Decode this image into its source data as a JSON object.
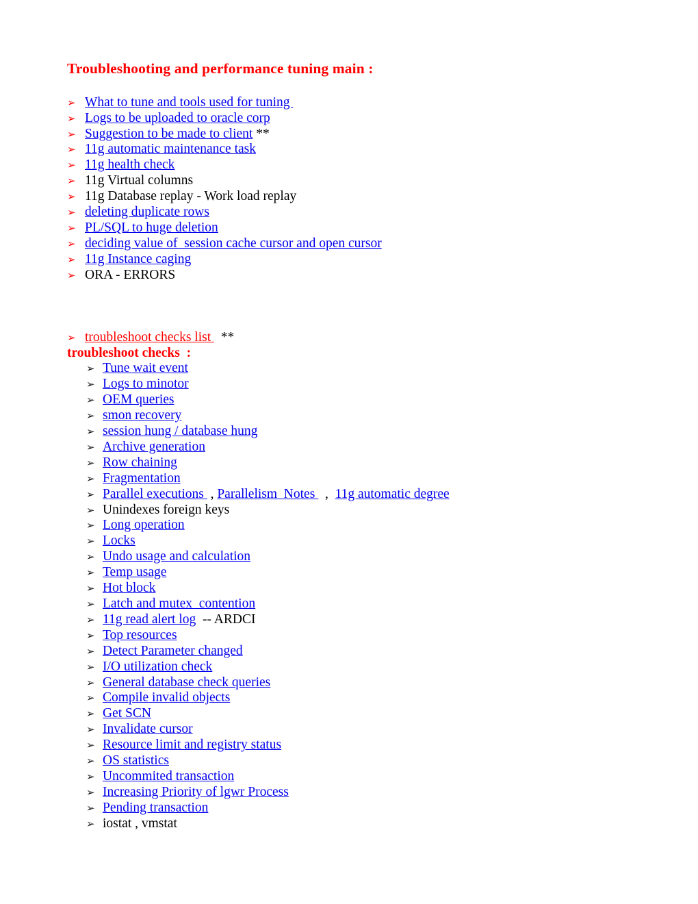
{
  "document": {
    "title": "Troubleshooting and performance tuning main :",
    "bullet_glyph": "➢",
    "colors": {
      "title": "#FF0000",
      "link": "#0000EE",
      "red_link": "#FF0000",
      "text": "#000000",
      "bullet_level1": "#FF0000",
      "bullet_level2": "#1A1A1A",
      "background": "#FFFFFF"
    }
  },
  "main_list": [
    {
      "link": "What to tune and tools used for tuning ",
      "suffix": ""
    },
    {
      "link": "Logs to be uploaded to oracle corp",
      "suffix": ""
    },
    {
      "link": "Suggestion to be made to client",
      "suffix": " **"
    },
    {
      "link": "11g automatic maintenance task",
      "suffix": ""
    },
    {
      "link": "11g health check",
      "suffix": ""
    },
    {
      "link": "",
      "suffix": "11g Virtual columns"
    },
    {
      "link": "",
      "suffix": "11g Database replay - Work load replay"
    },
    {
      "link": "deleting duplicate rows",
      "suffix": ""
    },
    {
      "link": "PL/SQL to huge deletion",
      "suffix": ""
    },
    {
      "link": "deciding value of  session cache cursor and open cursor",
      "suffix": ""
    },
    {
      "link": "11g Instance caging",
      "suffix": ""
    },
    {
      "link": "",
      "suffix": "ORA - ERRORS"
    }
  ],
  "checks_entry": {
    "link": "troubleshoot checks list ",
    "suffix": "  **"
  },
  "checks_heading": "troubleshoot checks  :",
  "checks_list": [
    {
      "link": "Tune wait event",
      "suffix": ""
    },
    {
      "link": "Logs to minotor",
      "suffix": ""
    },
    {
      "link": "OEM queries",
      "suffix": ""
    },
    {
      "link": "smon recovery",
      "suffix": ""
    },
    {
      "link": "session hung / database hung",
      "suffix": ""
    },
    {
      "link": "Archive generation",
      "suffix": ""
    },
    {
      "link": "Row chaining",
      "suffix": ""
    },
    {
      "link": "Fragmentation",
      "suffix": ""
    },
    {
      "multi": [
        {
          "type": "link",
          "text": "Parallel executions "
        },
        {
          "type": "text",
          "text": " , "
        },
        {
          "type": "link",
          "text": "Parallelism  Notes "
        },
        {
          "type": "text",
          "text": "  ,  "
        },
        {
          "type": "link",
          "text": "11g automatic degree"
        }
      ]
    },
    {
      "link": "",
      "suffix": "Unindexes foreign keys"
    },
    {
      "link": "Long operation",
      "suffix": ""
    },
    {
      "link": "Locks",
      "suffix": ""
    },
    {
      "link": "Undo usage and calculation",
      "suffix": ""
    },
    {
      "link": "Temp usage",
      "suffix": ""
    },
    {
      "link": "Hot block",
      "suffix": ""
    },
    {
      "link": "Latch and mutex  contention",
      "suffix": ""
    },
    {
      "link": "11g read alert log",
      "suffix": "  -- ARDCI"
    },
    {
      "link": "Top resources",
      "suffix": ""
    },
    {
      "link": "Detect Parameter changed",
      "suffix": ""
    },
    {
      "link": "I/O utilization check",
      "suffix": ""
    },
    {
      "link": "General database check queries",
      "suffix": ""
    },
    {
      "link": "Compile invalid objects",
      "suffix": ""
    },
    {
      "link": "Get SCN",
      "suffix": ""
    },
    {
      "link": "Invalidate cursor",
      "suffix": ""
    },
    {
      "link": "Resource limit and registry status",
      "suffix": ""
    },
    {
      "link": "OS statistics",
      "suffix": ""
    },
    {
      "link": "Uncommited transaction",
      "suffix": ""
    },
    {
      "link": "Increasing Priority of lgwr Process",
      "suffix": ""
    },
    {
      "link": "Pending transaction",
      "suffix": ""
    },
    {
      "link": "",
      "suffix": "iostat , vmstat"
    }
  ]
}
